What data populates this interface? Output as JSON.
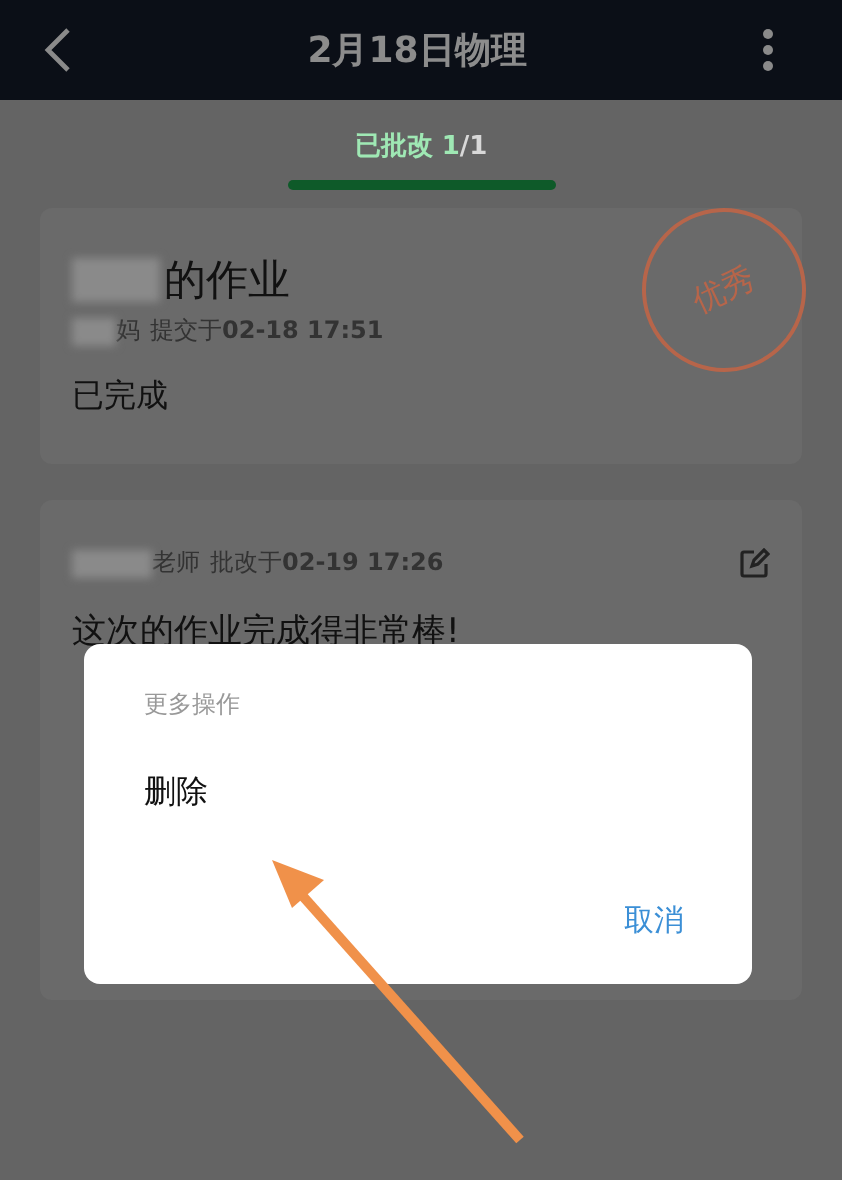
{
  "header": {
    "title": "2月18日物理"
  },
  "tabs": [
    {
      "label": "已批改",
      "count": "1",
      "total": "/1",
      "selected": true
    }
  ],
  "homework": {
    "title": "的作业",
    "submitter": "妈",
    "meta": "提交于**02-18 17:51**",
    "status": "已完成",
    "stamp": "优秀"
  },
  "review": {
    "role": "老师",
    "meta": "批改于**02-19 17:26**",
    "comment": "这次的作业完成得非常棒!"
  },
  "dialog": {
    "title": "更多操作",
    "options": [
      "删除"
    ],
    "cancel": "取消"
  }
}
